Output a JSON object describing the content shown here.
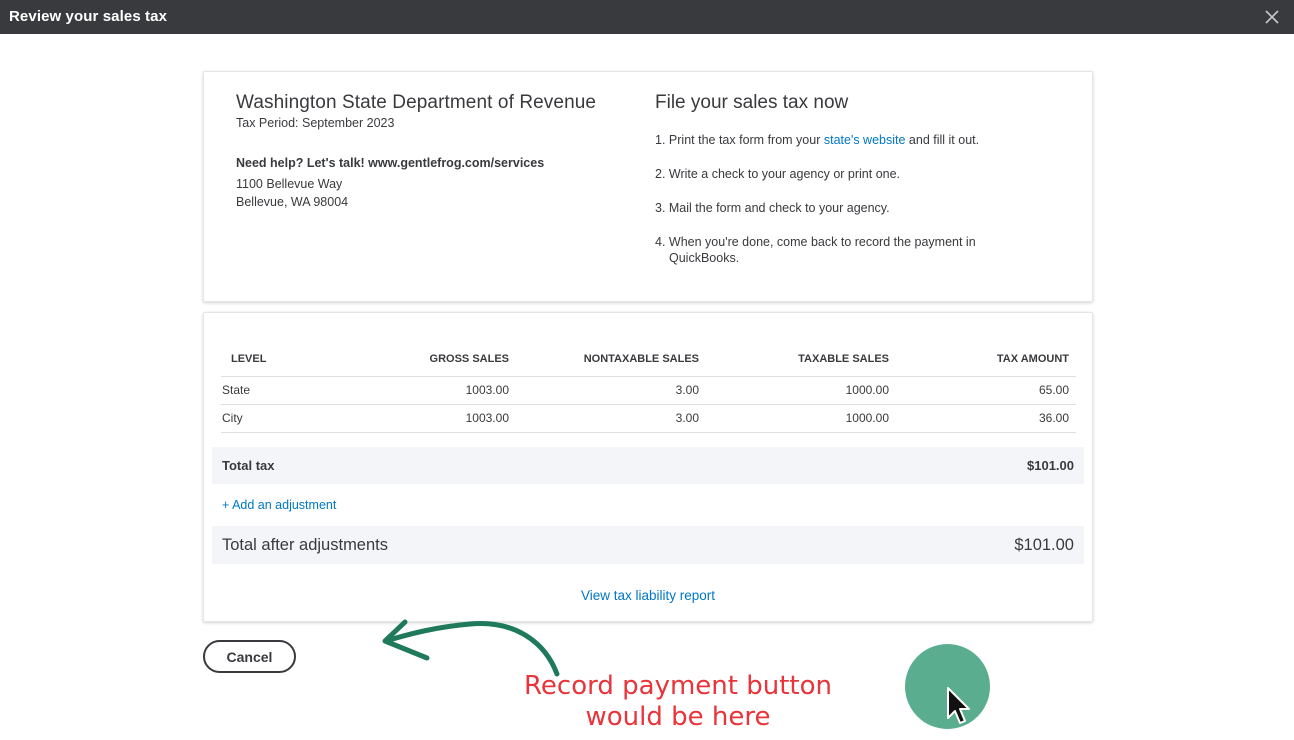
{
  "titlebar": {
    "title": "Review your sales tax",
    "close_icon": "close-icon"
  },
  "agency": {
    "name": "Washington State Department of Revenue",
    "tax_period": "Tax Period: September 2023",
    "help": "Need help? Let's talk! www.gentlefrog.com/services",
    "address_line1": "1100 Bellevue Way",
    "address_line2": "Bellevue, WA 98004"
  },
  "file_now": {
    "title": "File your sales tax now",
    "step1_num": "1.",
    "step1_pre": "Print the tax form from your ",
    "step1_link": "state's website",
    "step1_post": " and fill it out.",
    "step2": "2. Write a check to your agency or print one.",
    "step3": "3. Mail the form and check to your agency.",
    "step4_num": "4.",
    "step4_a": "When you're done, come back to record the payment in",
    "step4_b": "QuickBooks."
  },
  "table": {
    "headers": [
      "LEVEL",
      "GROSS SALES",
      "NONTAXABLE SALES",
      "TAXABLE SALES",
      "TAX AMOUNT"
    ],
    "rows": [
      [
        "State",
        "1003.00",
        "3.00",
        "1000.00",
        "65.00"
      ],
      [
        "City",
        "1003.00",
        "3.00",
        "1000.00",
        "36.00"
      ]
    ]
  },
  "totals": {
    "total_tax_label": "Total tax",
    "total_tax_value": "$101.00",
    "add_adjustment": "+ Add an adjustment",
    "after_label": "Total after adjustments",
    "after_value": "$101.00",
    "view_report": "View tax liability report"
  },
  "footer": {
    "cancel_label": "Cancel",
    "annotation_line1": "Record payment button",
    "annotation_line2": "would be here"
  },
  "colors": {
    "titlebar": "#393a3d",
    "link": "#0077c5",
    "annotation": "#e8343a",
    "arrow": "#1f7a5c",
    "cursor_highlight": "#5aae8f"
  }
}
